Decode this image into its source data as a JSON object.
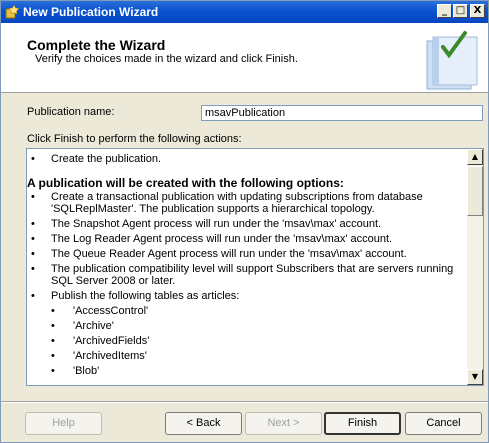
{
  "window": {
    "title": "New Publication Wizard"
  },
  "header": {
    "title": "Complete the Wizard",
    "subtitle": "Verify the choices made in the wizard and click Finish."
  },
  "publication_name": {
    "label": "Publication name:",
    "value": "msavPublication"
  },
  "actions_label": "Click Finish to perform the following actions:",
  "actions": [
    {
      "kind": "bullet",
      "text": "Create the publication."
    },
    {
      "kind": "heading",
      "text": "A publication will be created with the following options:"
    },
    {
      "kind": "bullet",
      "text": "Create a transactional publication with updating subscriptions from database 'SQLReplMaster'. The publication supports a hierarchical topology."
    },
    {
      "kind": "bullet",
      "text": "The Snapshot Agent process will run under the 'msav\\max' account."
    },
    {
      "kind": "bullet",
      "text": "The Log Reader Agent process will run under the 'msav\\max' account."
    },
    {
      "kind": "bullet",
      "text": "The Queue Reader Agent process will run under the 'msav\\max' account."
    },
    {
      "kind": "bullet",
      "text": "The publication compatibility level will support Subscribers that are servers running SQL Server 2008 or later."
    },
    {
      "kind": "bullet",
      "text": "Publish the following tables as articles:"
    },
    {
      "kind": "sub",
      "text": "'AccessControl'"
    },
    {
      "kind": "sub",
      "text": "'Archive'"
    },
    {
      "kind": "sub",
      "text": "'ArchivedFields'"
    },
    {
      "kind": "sub",
      "text": "'ArchivedItems'"
    },
    {
      "kind": "sub",
      "text": "'Blob'"
    }
  ],
  "buttons": {
    "help": "Help",
    "back": "< Back",
    "next": "Next >",
    "finish": "Finish",
    "cancel": "Cancel"
  },
  "caption_buttons": {
    "minimize": "_",
    "maximize": "□",
    "close": "X"
  },
  "scroll_glyphs": {
    "up": "▲",
    "down": "▼"
  },
  "icons": {
    "app": "wizard-app-icon",
    "header_art": "wizard-checklist-book-icon"
  },
  "colors": {
    "titlebar": "#0a52d0",
    "dialog_bg": "#ece9d8"
  }
}
